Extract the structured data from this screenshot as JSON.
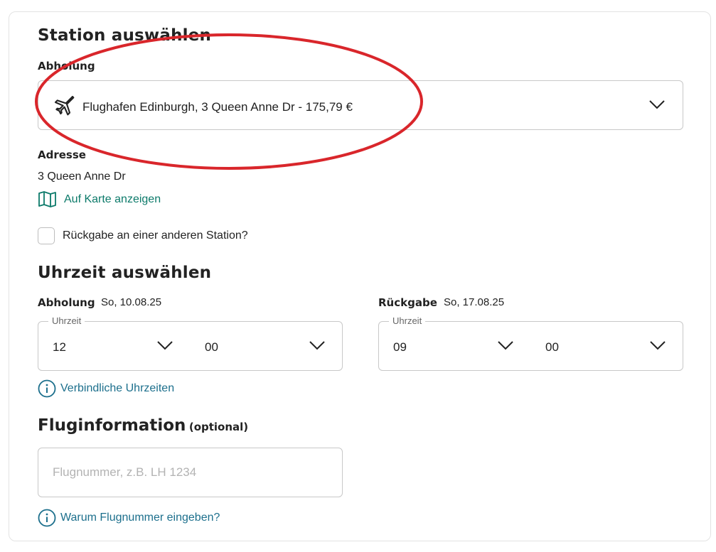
{
  "station": {
    "title": "Station auswählen",
    "pickup_label": "Abholung",
    "selected_station": "Flughafen Edinburgh, 3 Queen Anne Dr - 175,79 €",
    "address_label": "Adresse",
    "address_value": "3 Queen Anne Dr",
    "map_link": "Auf Karte anzeigen",
    "return_other_station": "Rückgabe an einer anderen Station?"
  },
  "time": {
    "title": "Uhrzeit auswählen",
    "pickup": {
      "label": "Abholung",
      "date": "So, 10.08.25",
      "legend": "Uhrzeit",
      "hour": "12",
      "minute": "00"
    },
    "return": {
      "label": "Rückgabe",
      "date": "So, 17.08.25",
      "legend": "Uhrzeit",
      "hour": "09",
      "minute": "00"
    },
    "info_link": "Verbindliche Uhrzeiten"
  },
  "flight": {
    "title": "Fluginformation",
    "optional": "(optional)",
    "placeholder": "Flugnummer, z.B. LH 1234",
    "info_link": "Warum Flugnummer eingeben?"
  },
  "icons": {
    "plane": "airplane-icon",
    "map": "map-icon",
    "chevron": "chevron-down-icon",
    "info": "info-icon"
  },
  "colors": {
    "accent_link": "#0c7a6a",
    "info_link": "#1c6f8c",
    "annotation": "#d9262b"
  }
}
